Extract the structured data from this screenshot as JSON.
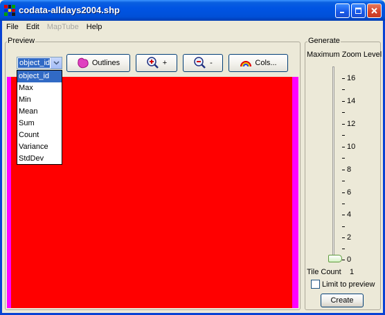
{
  "window": {
    "title": "codata-alldays2004.shp"
  },
  "menu": {
    "items": [
      {
        "label": "File",
        "enabled": true
      },
      {
        "label": "Edit",
        "enabled": true
      },
      {
        "label": "MapTube",
        "enabled": false
      },
      {
        "label": "Help",
        "enabled": true
      }
    ]
  },
  "preview": {
    "title": "Preview",
    "field_select": {
      "value": "object_id",
      "options": [
        "object_id",
        "Max",
        "Min",
        "Mean",
        "Sum",
        "Count",
        "Variance",
        "StdDev"
      ]
    },
    "buttons": {
      "outlines": "Outlines",
      "zoom_in": "+",
      "zoom_out": "-",
      "colours": "Cols..."
    },
    "colors": {
      "fill": "#ff0000",
      "edge": "#ff00ff"
    }
  },
  "generate": {
    "title": "Generate",
    "max_zoom_label": "Maximum Zoom Level",
    "ticks": [
      "16",
      "14",
      "12",
      "10",
      "8",
      "6",
      "4",
      "2",
      "0"
    ],
    "zoom_value": 0,
    "tile_count_label": "Tile Count",
    "tile_count": "1",
    "limit_label": "Limit to preview",
    "limit_checked": false,
    "create_label": "Create"
  }
}
